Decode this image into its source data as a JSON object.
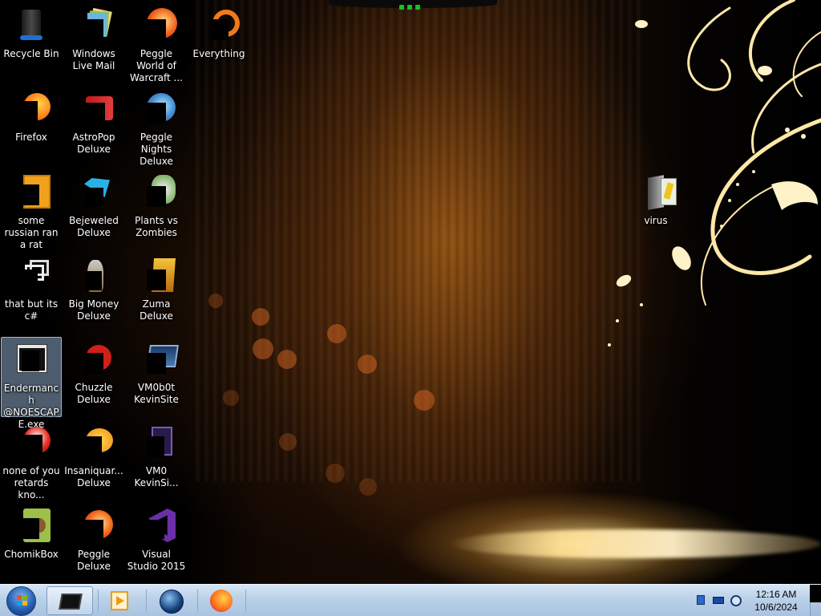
{
  "desktop": {
    "icons": [
      {
        "label": "Recycle Bin"
      },
      {
        "label": "Windows Live Mail"
      },
      {
        "label": "Peggle World of Warcraft ..."
      },
      {
        "label": "Everything"
      },
      {
        "label": "Firefox"
      },
      {
        "label": "AstroPop Deluxe"
      },
      {
        "label": "Peggle Nights Deluxe"
      },
      {
        "label": "some russian ran a rat"
      },
      {
        "label": "Bejeweled Deluxe"
      },
      {
        "label": "Plants vs Zombies"
      },
      {
        "label": "that but its c#"
      },
      {
        "label": "Big Money Deluxe"
      },
      {
        "label": "Zuma Deluxe"
      },
      {
        "label": "Endermanch @NOESCAPE.exe"
      },
      {
        "label": "Chuzzle Deluxe"
      },
      {
        "label": "VM0b0t KevinSite"
      },
      {
        "label": "none of you retards kno..."
      },
      {
        "label": "Insaniquar... Deluxe"
      },
      {
        "label": "VM0 KevinSi..."
      },
      {
        "label": "ChomikBox"
      },
      {
        "label": "Peggle Deluxe"
      },
      {
        "label": "Visual Studio 2015"
      },
      {
        "label": "virus"
      }
    ]
  },
  "taskbar": {
    "clock_time": "12:16 AM",
    "clock_date": "10/6/2024",
    "pinned": [
      "command-prompt",
      "media-player",
      "globe-app",
      "firefox"
    ]
  },
  "colors": {
    "taskbar": "#b9d0e8",
    "selection": "#8caac8",
    "wallpaper_accent": "#ffd77a"
  }
}
